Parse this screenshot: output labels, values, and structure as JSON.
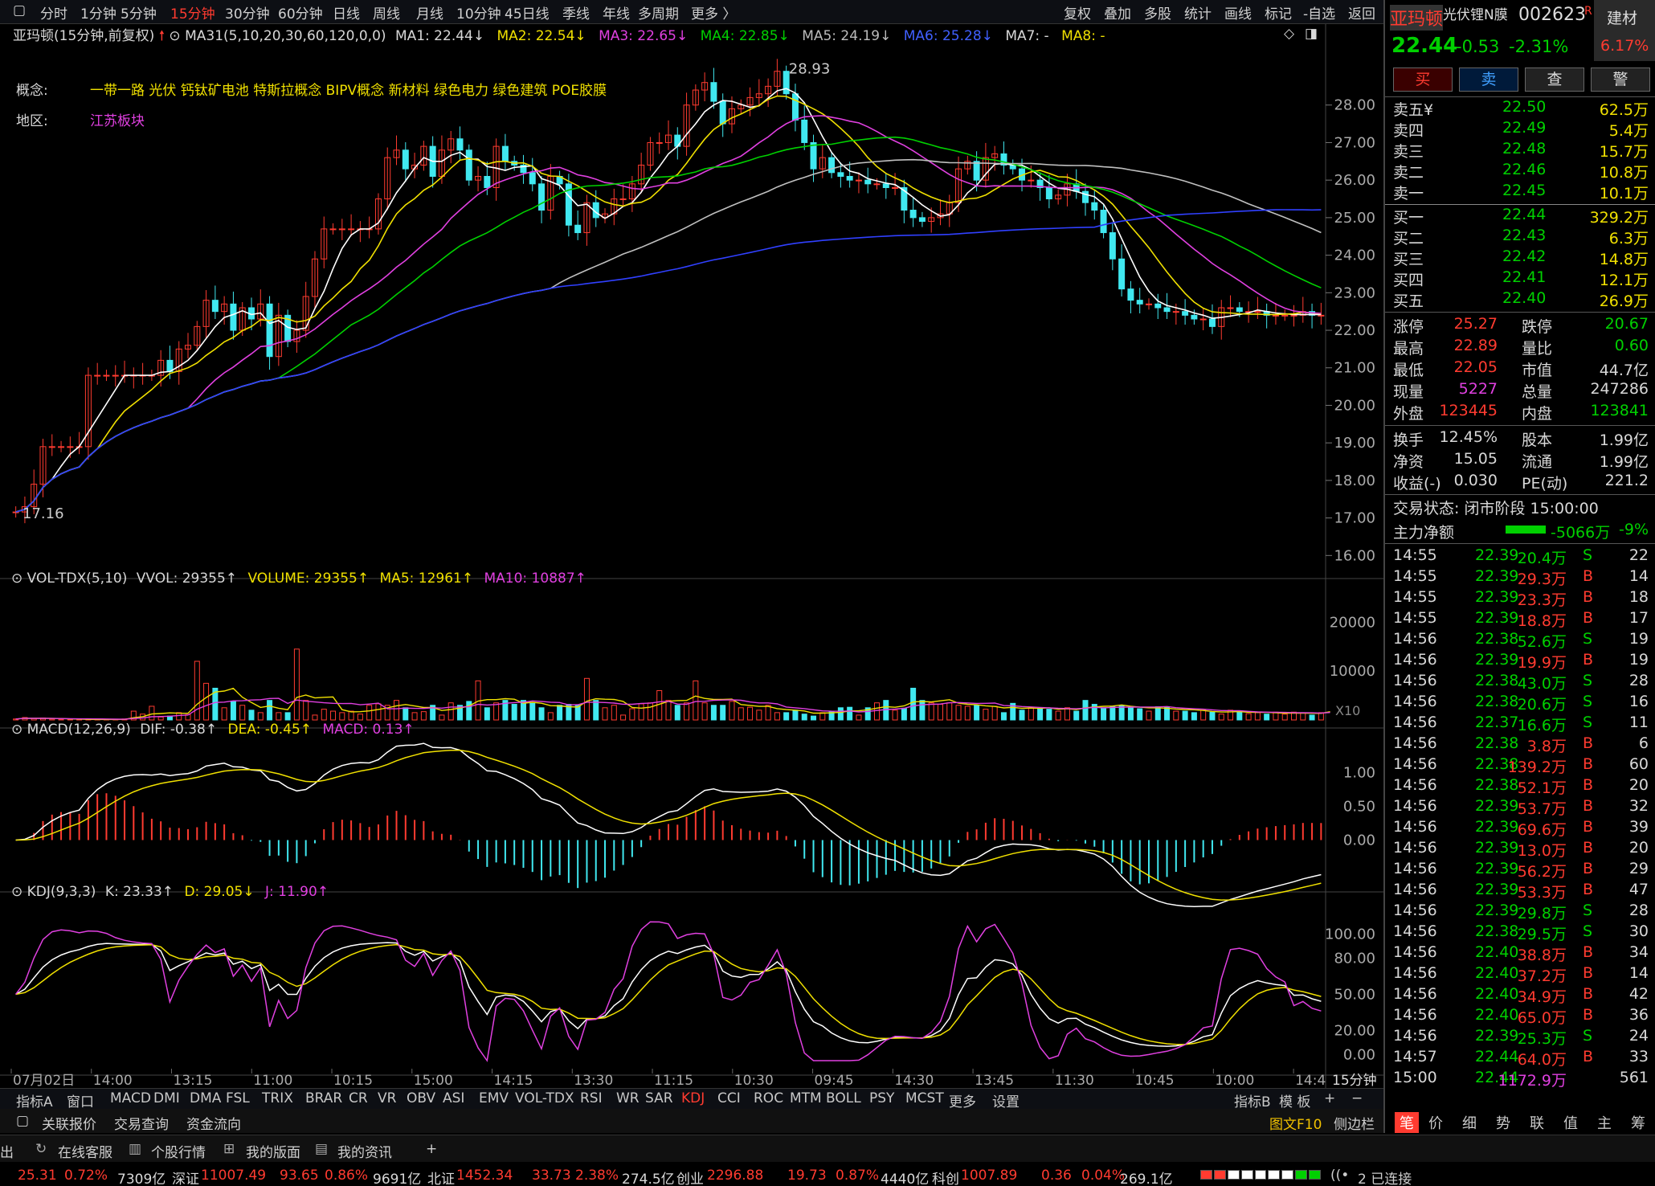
{
  "periods": [
    "分时",
    "1分钟",
    "5分钟",
    "15分钟",
    "30分钟",
    "60分钟",
    "日线",
    "周线",
    "月线",
    "10分钟",
    "45日线",
    "季线",
    "年线",
    "多周期",
    "更多 〉"
  ],
  "active_period": "15分钟",
  "tools": [
    "复权",
    "叠加",
    "多股",
    "统计",
    "画线",
    "标记",
    "-自选",
    "返回"
  ],
  "ma_header": {
    "name": "亚玛顿(15分钟,前复权)",
    "ma31": "MA31(5,10,20,30,60,120,0,0)",
    "ma1": "MA1: 22.44↓",
    "ma2": "MA2: 22.54↓",
    "ma3": "MA3: 22.65↓",
    "ma4": "MA4: 22.85↓",
    "ma5": "MA5: 24.19↓",
    "ma6": "MA6: 25.28↓",
    "ma7": "MA7: -",
    "ma8": "MA8: -"
  },
  "concept": {
    "label": "概念:",
    "value": "一带一路 光伏 钙钛矿电池 特斯拉概念 BIPV概念 新材料 绿色电力 绿色建筑 POE胶膜"
  },
  "region": {
    "label": "地区:",
    "value": "江苏板块"
  },
  "price_axis": [
    "28.00",
    "27.00",
    "26.00",
    "25.00",
    "24.00",
    "23.00",
    "22.00",
    "21.00",
    "20.00",
    "19.00",
    "18.00",
    "17.00",
    "16.00"
  ],
  "high_label": "28.93",
  "low_label": "17.16",
  "vol_header": {
    "name": "VOL-TDX(5,10)",
    "vvol": "VVOL: 29355↑",
    "volume": "VOLUME: 29355↑",
    "ma5": "MA5: 12961↑",
    "ma10": "MA10: 10887↑"
  },
  "vol_axis": [
    "20000",
    "10000"
  ],
  "vol_unit": "X10",
  "macd_header": {
    "name": "MACD(12,26,9)",
    "dif": "DIF: -0.38↑",
    "dea": "DEA: -0.45↑",
    "macd": "MACD: 0.13↑"
  },
  "macd_axis": [
    "1.00",
    "0.50",
    "0.00"
  ],
  "kdj_header": {
    "name": "KDJ(9,3,3)",
    "k": "K: 23.33↑",
    "d": "D: 29.05↓",
    "j": "J: 11.90↑"
  },
  "kdj_axis": [
    "100.00",
    "80.00",
    "50.00",
    "20.00",
    "0.00"
  ],
  "time_axis": [
    "07月02日",
    "14:00",
    "13:15",
    "11:00",
    "10:15",
    "15:00",
    "14:15",
    "13:30",
    "11:15",
    "10:30",
    "09:45",
    "14:30",
    "13:45",
    "11:30",
    "10:45",
    "10:00",
    "14:4"
  ],
  "time_period_label": "15分钟",
  "ind_tabs": [
    "指标A",
    "窗口",
    "MACD",
    "DMI",
    "DMA",
    "FSL",
    "TRIX",
    "BRAR",
    "CR",
    "VR",
    "OBV",
    "ASI",
    "EMV",
    "VOL-TDX",
    "RSI",
    "WR",
    "SAR",
    "KDJ",
    "CCI",
    "ROC",
    "MTM",
    "BOLL",
    "PSY",
    "MCST",
    "更多",
    "设置"
  ],
  "active_ind": "KDJ",
  "ind_right": [
    "指标B",
    "模 板",
    "+",
    "−"
  ],
  "menu": [
    "关联报价",
    "交易查询",
    "资金流向"
  ],
  "menu_right": [
    "图文F10",
    "侧边栏"
  ],
  "status": [
    "出",
    "在线客服",
    "个股行情",
    "我的版面",
    "我的资讯",
    "+"
  ],
  "ticker": [
    {
      "t": "25.31",
      "c": "r"
    },
    {
      "t": "0.72%",
      "c": "r"
    },
    {
      "t": "7309亿",
      "c": "w"
    },
    {
      "t": "深证",
      "c": "w"
    },
    {
      "t": "11007.49",
      "c": "r"
    },
    {
      "t": "93.65",
      "c": "r"
    },
    {
      "t": "0.86%",
      "c": "r"
    },
    {
      "t": "9691亿",
      "c": "w"
    },
    {
      "t": "北证",
      "c": "w"
    },
    {
      "t": "1452.34",
      "c": "r"
    },
    {
      "t": "33.73",
      "c": "r"
    },
    {
      "t": "2.38%",
      "c": "r"
    },
    {
      "t": "274.5亿",
      "c": "w"
    },
    {
      "t": "创业",
      "c": "w"
    },
    {
      "t": "2296.88",
      "c": "r"
    },
    {
      "t": "19.73",
      "c": "r"
    },
    {
      "t": "0.87%",
      "c": "r"
    },
    {
      "t": "4440亿",
      "c": "w"
    },
    {
      "t": "科创",
      "c": "w"
    },
    {
      "t": "1007.89",
      "c": "r"
    },
    {
      "t": "0.36",
      "c": "r"
    },
    {
      "t": "0.04%",
      "c": "r"
    },
    {
      "t": "269.1亿",
      "c": "w"
    }
  ],
  "connection": "2 已连接",
  "stock": {
    "name": "亚玛顿",
    "sub": "光伏锂N膜",
    "code": "002623",
    "r": "R",
    "sector": "建材",
    "sector_chg": "6.17%",
    "price": "22.44",
    "chg": "-0.53",
    "pct": "-2.31%"
  },
  "trade_buttons": [
    "买",
    "卖",
    "查",
    "警"
  ],
  "asks": [
    {
      "l": "卖五¥",
      "p": "22.50",
      "v": "62.5万"
    },
    {
      "l": "卖四",
      "p": "22.49",
      "v": "5.4万"
    },
    {
      "l": "卖三",
      "p": "22.48",
      "v": "15.7万"
    },
    {
      "l": "卖二",
      "p": "22.46",
      "v": "10.8万"
    },
    {
      "l": "卖一",
      "p": "22.45",
      "v": "10.1万"
    }
  ],
  "bids": [
    {
      "l": "买一",
      "p": "22.44",
      "v": "329.2万"
    },
    {
      "l": "买二",
      "p": "22.43",
      "v": "6.3万"
    },
    {
      "l": "买三",
      "p": "22.42",
      "v": "14.8万"
    },
    {
      "l": "买四",
      "p": "22.41",
      "v": "12.1万"
    },
    {
      "l": "买五",
      "p": "22.40",
      "v": "26.9万"
    }
  ],
  "stats1": [
    [
      "涨停",
      "25.27",
      "r",
      "跌停",
      "20.67",
      "g"
    ],
    [
      "最高",
      "22.89",
      "r",
      "量比",
      "0.60",
      "g"
    ],
    [
      "最低",
      "22.05",
      "r",
      "市值",
      "44.7亿",
      "w"
    ],
    [
      "现量",
      "5227",
      "m",
      "总量",
      "247286",
      "w"
    ],
    [
      "外盘",
      "123445",
      "r",
      "内盘",
      "123841",
      "g"
    ]
  ],
  "stats2": [
    [
      "换手",
      "12.45%",
      "w",
      "股本",
      "1.99亿",
      "w"
    ],
    [
      "净资",
      "15.05",
      "w",
      "流通",
      "1.99亿",
      "w"
    ],
    [
      "收益(-)",
      "0.030",
      "w",
      "PE(动)",
      "221.2",
      "w"
    ]
  ],
  "trade_status": "交易状态: 闭市阶段 15:00:00",
  "main_flow": {
    "label": "主力净额",
    "value": "-5066万",
    "pct": "-9%"
  },
  "ticks": [
    [
      "14:55",
      "22.39",
      "20.4万",
      "S",
      "22"
    ],
    [
      "14:55",
      "22.39",
      "29.3万",
      "B",
      "14"
    ],
    [
      "14:55",
      "22.39",
      "23.3万",
      "B",
      "18"
    ],
    [
      "14:55",
      "22.39",
      "18.8万",
      "B",
      "17"
    ],
    [
      "14:56",
      "22.38",
      "52.6万",
      "S",
      "19"
    ],
    [
      "14:56",
      "22.39",
      "19.9万",
      "B",
      "19"
    ],
    [
      "14:56",
      "22.38",
      "43.0万",
      "S",
      "28"
    ],
    [
      "14:56",
      "22.38",
      "20.6万",
      "S",
      "16"
    ],
    [
      "14:56",
      "22.37",
      "16.6万",
      "S",
      "11"
    ],
    [
      "14:56",
      "22.38",
      "3.8万",
      "B",
      "6"
    ],
    [
      "14:56",
      "22.38",
      "139.2万",
      "B",
      "60"
    ],
    [
      "14:56",
      "22.38",
      "52.1万",
      "B",
      "20"
    ],
    [
      "14:56",
      "22.39",
      "53.7万",
      "B",
      "32"
    ],
    [
      "14:56",
      "22.39",
      "69.6万",
      "B",
      "39"
    ],
    [
      "14:56",
      "22.39",
      "13.0万",
      "B",
      "20"
    ],
    [
      "14:56",
      "22.39",
      "56.2万",
      "B",
      "29"
    ],
    [
      "14:56",
      "22.39",
      "53.3万",
      "B",
      "47"
    ],
    [
      "14:56",
      "22.39",
      "29.8万",
      "S",
      "28"
    ],
    [
      "14:56",
      "22.38",
      "29.5万",
      "S",
      "30"
    ],
    [
      "14:56",
      "22.40",
      "38.8万",
      "B",
      "34"
    ],
    [
      "14:56",
      "22.40",
      "37.2万",
      "B",
      "14"
    ],
    [
      "14:56",
      "22.40",
      "34.9万",
      "B",
      "42"
    ],
    [
      "14:56",
      "22.40",
      "65.0万",
      "B",
      "36"
    ],
    [
      "14:56",
      "22.39",
      "25.3万",
      "S",
      "24"
    ],
    [
      "14:57",
      "22.44",
      "64.0万",
      "B",
      "33"
    ],
    [
      "15:00",
      "22.44",
      "1172.9万",
      "",
      "561"
    ]
  ],
  "rp_tabs": [
    "笔",
    "价",
    "细",
    "势",
    "联",
    "值",
    "主",
    "筹"
  ],
  "chart_data": {
    "type": "candlestick",
    "x": [
      "07月02日",
      "14:00",
      "13:15",
      "11:00",
      "10:15",
      "15:00",
      "14:15",
      "13:30",
      "11:15",
      "10:30",
      "09:45",
      "14:30",
      "13:45",
      "11:30",
      "10:45",
      "10:00",
      "14:4"
    ],
    "price_range": [
      15.6,
      29.3
    ],
    "high": 28.93,
    "low": 17.16,
    "close": [
      17.16,
      17.3,
      17.9,
      18.9,
      18.9,
      18.9,
      18.9,
      18.9,
      20.8,
      20.8,
      20.8,
      20.8,
      20.8,
      20.8,
      20.8,
      20.8,
      21.2,
      20.9,
      21.5,
      21.6,
      22.1,
      22.8,
      22.5,
      22.7,
      22.0,
      22.6,
      22.3,
      22.7,
      21.3,
      22.4,
      21.7,
      22.0,
      22.9,
      23.9,
      24.7,
      24.7,
      24.7,
      24.7,
      24.7,
      24.7,
      25.5,
      26.6,
      26.8,
      26.3,
      26.4,
      26.9,
      26.1,
      26.8,
      27.1,
      26.8,
      26.0,
      26.1,
      25.8,
      26.9,
      26.5,
      26.4,
      26.2,
      25.9,
      25.2,
      26.1,
      25.9,
      24.8,
      24.6,
      25.4,
      25.0,
      25.1,
      25.5,
      25.5,
      25.9,
      26.4,
      27.0,
      27.0,
      27.2,
      26.9,
      28.0,
      28.4,
      28.6,
      28.1,
      27.5,
      27.9,
      28.0,
      28.2,
      28.3,
      28.5,
      28.9,
      28.3,
      27.6,
      27.0,
      26.3,
      26.6,
      26.2,
      26.1,
      26.0,
      26.0,
      25.9,
      25.9,
      25.8,
      25.8,
      25.2,
      25.0,
      24.9,
      25.0,
      25.1,
      25.4,
      26.3,
      26.5,
      26.0,
      26.6,
      26.7,
      26.4,
      26.3,
      26.0,
      26.0,
      25.8,
      25.5,
      25.6,
      25.9,
      25.7,
      25.4,
      25.2,
      24.6,
      23.9,
      23.1,
      22.8,
      22.7,
      22.7,
      22.6,
      22.5,
      22.5,
      22.4,
      22.3,
      22.3,
      22.1,
      22.6,
      22.6,
      22.5,
      22.5,
      22.5,
      22.4,
      22.4,
      22.4,
      22.4,
      22.5,
      22.4,
      22.4
    ],
    "volume": [
      200,
      500,
      300,
      400,
      200,
      100,
      100,
      100,
      100,
      100,
      100,
      100,
      200,
      1800,
      1200,
      2800,
      600,
      800,
      1500,
      1100,
      12000,
      7500,
      6500,
      2500,
      3800,
      3000,
      2000,
      1500,
      4000,
      1500,
      1500,
      14500,
      4000,
      1000,
      2200,
      1800,
      1500,
      1800,
      1200,
      3000,
      3300,
      3000,
      4000,
      2500,
      1500,
      1700,
      3000,
      1000,
      3500,
      3000,
      3800,
      8000,
      2500,
      3500,
      4000,
      3200,
      4000,
      3400,
      2500,
      1500,
      3000,
      3200,
      3000,
      8500,
      4000,
      2500,
      3000,
      1000,
      2300,
      3300,
      3500,
      6000,
      4000,
      3000,
      3500,
      8000,
      3500,
      3000,
      3000,
      3800,
      2500,
      2600,
      2000,
      3000,
      1500,
      1500,
      2000,
      1200,
      800,
      1500,
      1800,
      2500,
      2600,
      1000,
      2500,
      3500,
      4000,
      2000,
      2400,
      6500,
      4000,
      3500,
      3200,
      3500,
      3000,
      2800,
      3000,
      2200,
      2800,
      1500,
      3400,
      2000,
      2500,
      2400,
      2200,
      1800,
      2500,
      1800,
      4000,
      3200,
      2500,
      2700,
      3000,
      2600,
      2300,
      1800,
      2700,
      2600,
      1800,
      1800,
      1500,
      2000,
      1600,
      1200,
      2000,
      1800,
      1300,
      1500,
      1200,
      1600,
      1200,
      1600,
      1400,
      1000,
      1500,
      3000
    ],
    "macd_range": [
      -0.6,
      1.3
    ],
    "kdj_range": [
      -5,
      115
    ]
  }
}
